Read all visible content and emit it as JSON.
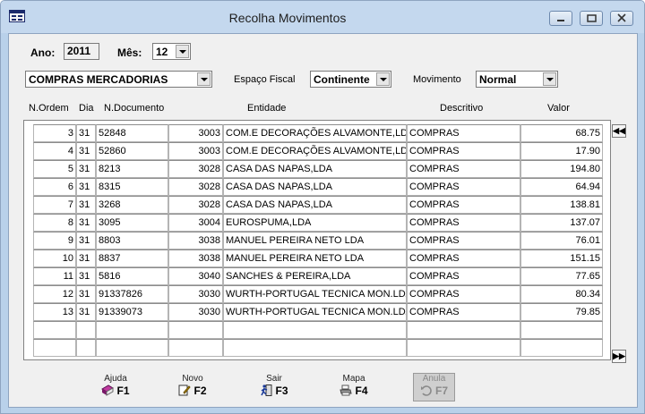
{
  "window": {
    "title": "Recolha Movimentos"
  },
  "filters": {
    "ano_label": "Ano:",
    "ano_value": "2011",
    "mes_label": "Mês:",
    "mes_value": "12",
    "category_value": "COMPRAS MERCADORIAS",
    "espaco_label": "Espaço Fiscal",
    "espaco_value": "Continente",
    "movimento_label": "Movimento",
    "movimento_value": "Normal"
  },
  "table": {
    "columns": [
      "N.Ordem",
      "Dia",
      "N.Documento",
      "Entidade",
      "Descritivo",
      "Valor"
    ],
    "rows": [
      {
        "ordem": "3",
        "dia": "31",
        "doc": "52848",
        "code": "3003",
        "entidade": "COM.E DECORAÇÕES ALVAMONTE,LDA",
        "descritivo": "COMPRAS",
        "valor": "68.75"
      },
      {
        "ordem": "4",
        "dia": "31",
        "doc": "52860",
        "code": "3003",
        "entidade": "COM.E DECORAÇÕES ALVAMONTE,LDA",
        "descritivo": "COMPRAS",
        "valor": "17.90"
      },
      {
        "ordem": "5",
        "dia": "31",
        "doc": "8213",
        "code": "3028",
        "entidade": "CASA DAS NAPAS,LDA",
        "descritivo": "COMPRAS",
        "valor": "194.80"
      },
      {
        "ordem": "6",
        "dia": "31",
        "doc": "8315",
        "code": "3028",
        "entidade": "CASA DAS NAPAS,LDA",
        "descritivo": "COMPRAS",
        "valor": "64.94"
      },
      {
        "ordem": "7",
        "dia": "31",
        "doc": "3268",
        "code": "3028",
        "entidade": "CASA DAS NAPAS,LDA",
        "descritivo": "COMPRAS",
        "valor": "138.81"
      },
      {
        "ordem": "8",
        "dia": "31",
        "doc": "3095",
        "code": "3004",
        "entidade": "EUROSPUMA,LDA",
        "descritivo": "COMPRAS",
        "valor": "137.07"
      },
      {
        "ordem": "9",
        "dia": "31",
        "doc": "8803",
        "code": "3038",
        "entidade": "MANUEL PEREIRA NETO LDA",
        "descritivo": "COMPRAS",
        "valor": "76.01"
      },
      {
        "ordem": "10",
        "dia": "31",
        "doc": "8837",
        "code": "3038",
        "entidade": "MANUEL PEREIRA NETO LDA",
        "descritivo": "COMPRAS",
        "valor": "151.15"
      },
      {
        "ordem": "11",
        "dia": "31",
        "doc": "5816",
        "code": "3040",
        "entidade": "SANCHES & PEREIRA,LDA",
        "descritivo": "COMPRAS",
        "valor": "77.65"
      },
      {
        "ordem": "12",
        "dia": "31",
        "doc": "91337826",
        "code": "3030",
        "entidade": "WURTH-PORTUGAL TECNICA MON.LDA",
        "descritivo": "COMPRAS",
        "valor": "80.34"
      },
      {
        "ordem": "13",
        "dia": "31",
        "doc": "91339073",
        "code": "3030",
        "entidade": "WURTH-PORTUGAL TECNICA MON.LDA",
        "descritivo": "COMPRAS",
        "valor": "79.85"
      }
    ],
    "nav_first": "◀◀",
    "nav_last": "▶▶"
  },
  "footer": {
    "buttons": [
      {
        "label": "Ajuda",
        "key": "F1",
        "icon": "book-icon"
      },
      {
        "label": "Novo",
        "key": "F2",
        "icon": "new-document-icon"
      },
      {
        "label": "Sair",
        "key": "F3",
        "icon": "exit-icon"
      },
      {
        "label": "Mapa",
        "key": "F4",
        "icon": "printer-icon"
      },
      {
        "label": "Anula",
        "key": "F7",
        "icon": "undo-icon"
      }
    ]
  }
}
